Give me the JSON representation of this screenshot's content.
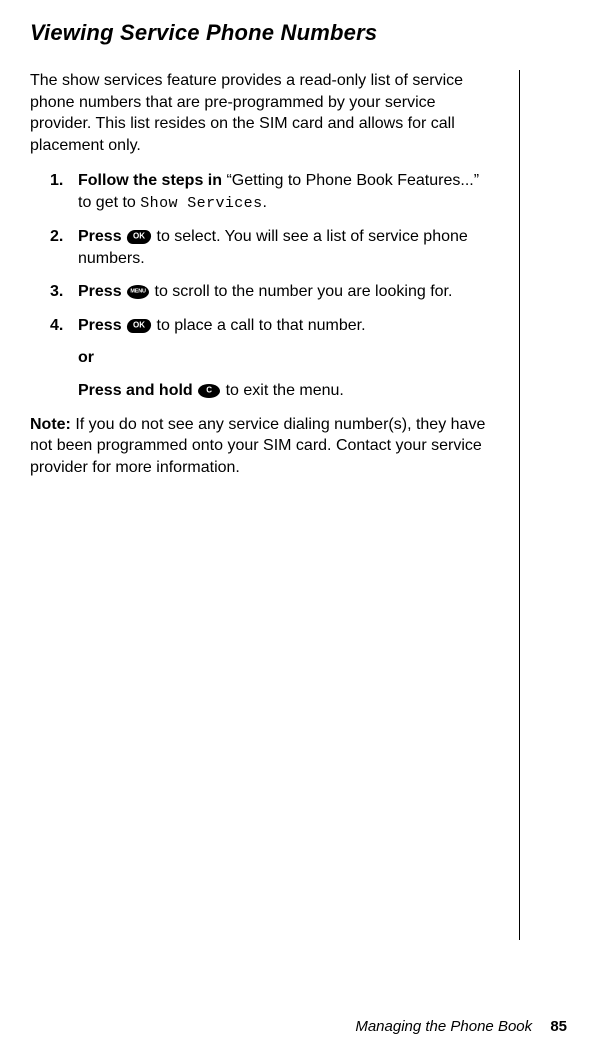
{
  "title": "Viewing Service Phone Numbers",
  "intro": "The show services feature provides a read-only list of service phone numbers that are pre-programmed by your service provider. This list resides on the SIM card and allows for call placement only.",
  "steps": {
    "s1": {
      "num": "1.",
      "boldLead": "Follow the steps in ",
      "quoted": "“Getting to Phone Book Features...” to get to ",
      "lcd": "Show Services",
      "tail": "."
    },
    "s2": {
      "num": "2.",
      "boldLead": "Press ",
      "tail": " to select. You will see a list of service phone numbers."
    },
    "s3": {
      "num": "3.",
      "boldLead": "Press ",
      "tail": " to scroll to the number you are looking for."
    },
    "s4": {
      "num": "4.",
      "boldLead": "Press ",
      "tail": " to place a call to that number.",
      "or": "or",
      "boldAlt": "Press and hold ",
      "altTail": " to exit the menu."
    }
  },
  "note": {
    "label": "Note:",
    "text": " If you do not see any service dialing number(s), they have not been programmed onto your SIM card. Contact your service provider for more information."
  },
  "footer": {
    "chapter": "Managing the Phone Book",
    "page": "85"
  }
}
